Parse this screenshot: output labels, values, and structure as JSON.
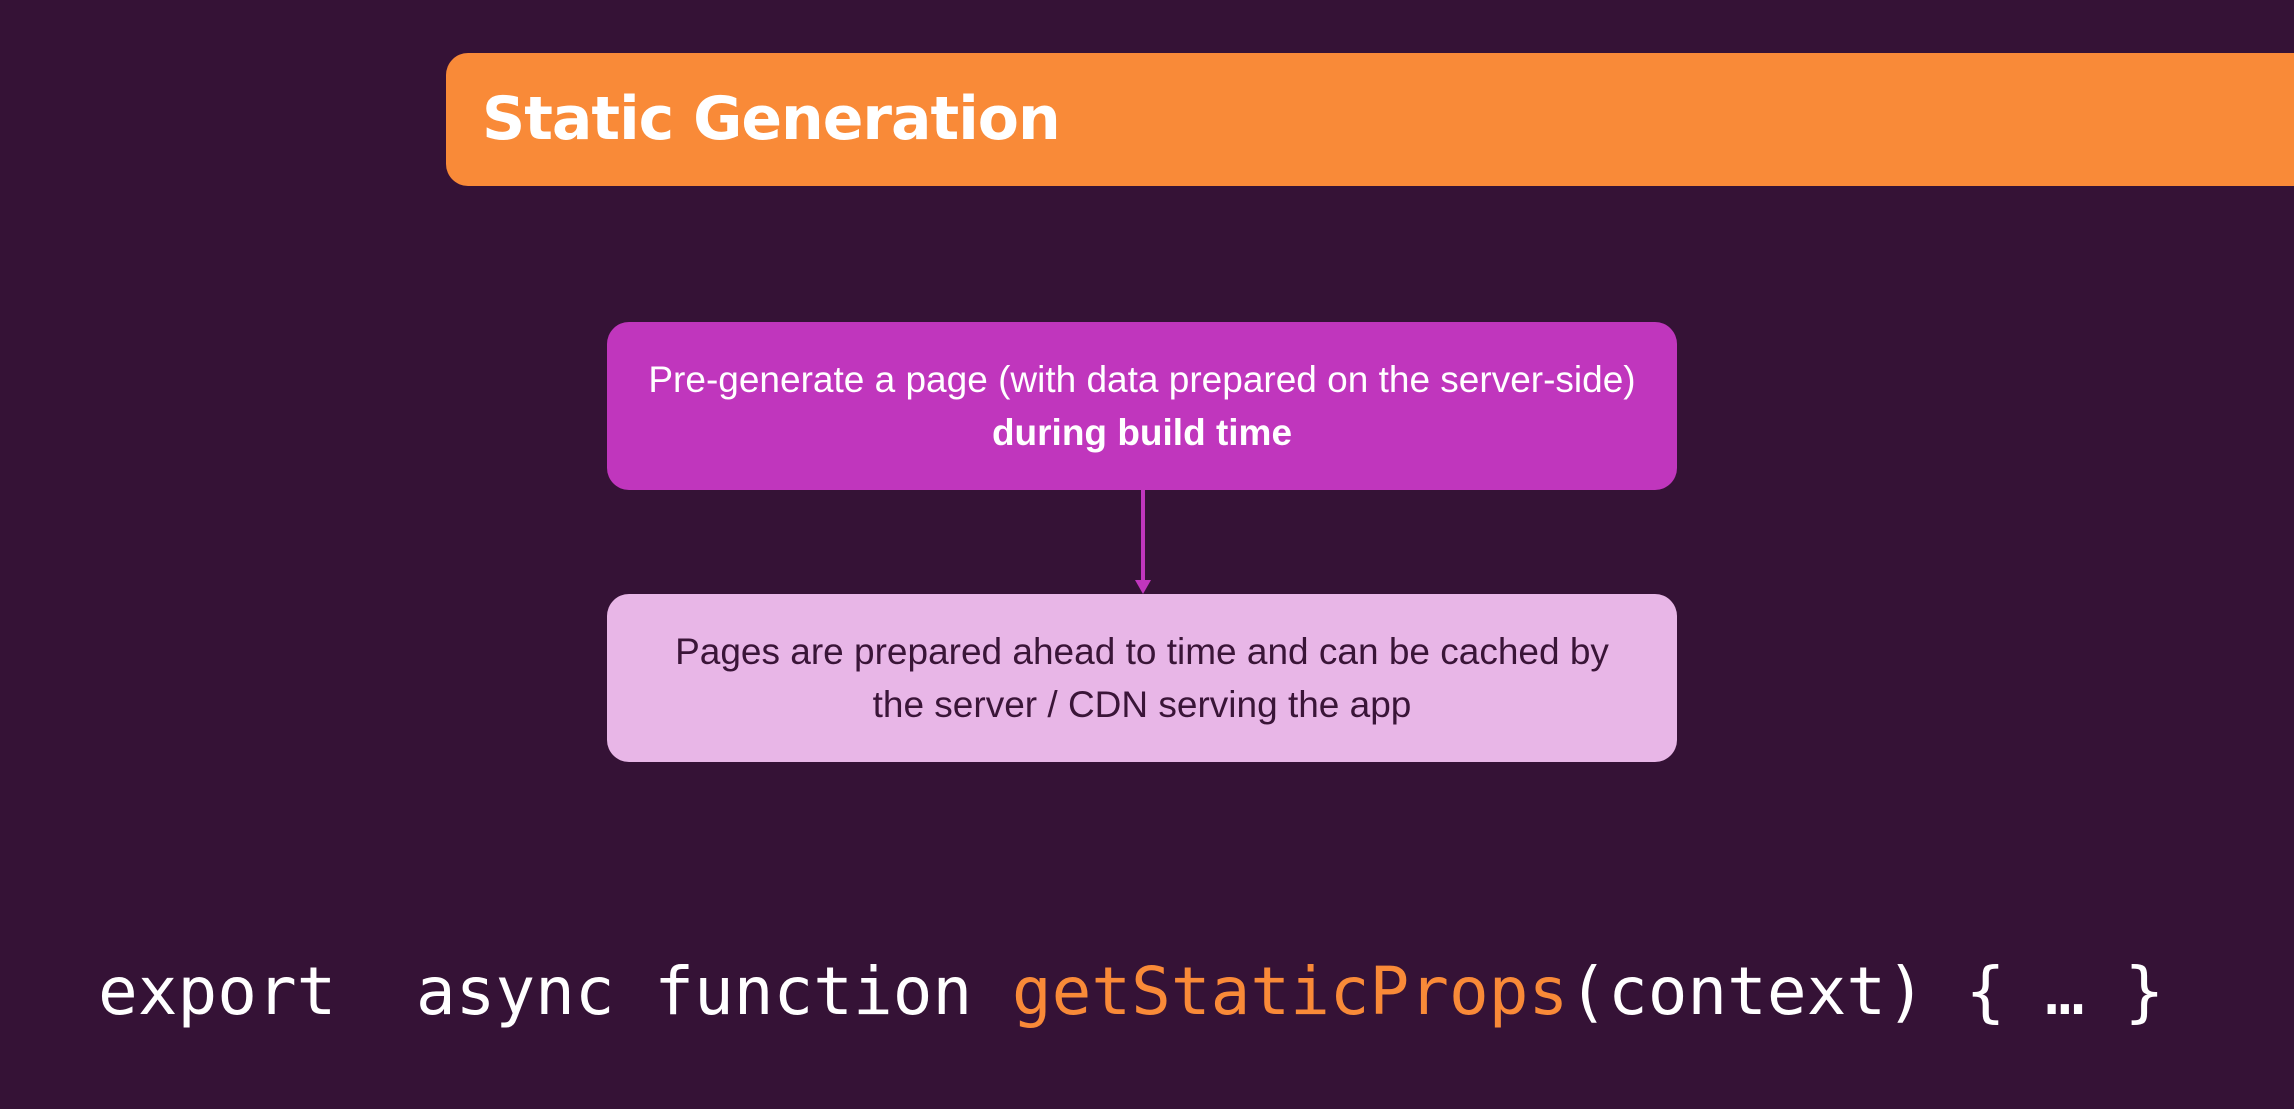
{
  "header": {
    "title": "Static Generation"
  },
  "diagram": {
    "box1": {
      "text": "Pre-generate a page (with data prepared on the server-side)",
      "bold": "during build time"
    },
    "box2": {
      "text": "Pages are prepared ahead to time and can be cached by the server / CDN serving the app"
    }
  },
  "code": {
    "prefix": "export  async function ",
    "function_name": "getStaticProps",
    "suffix": "(context) { … }"
  },
  "colors": {
    "background": "#351236",
    "accent": "#f98a38",
    "box1": "#c036bd",
    "box2": "#e8b6e7"
  }
}
